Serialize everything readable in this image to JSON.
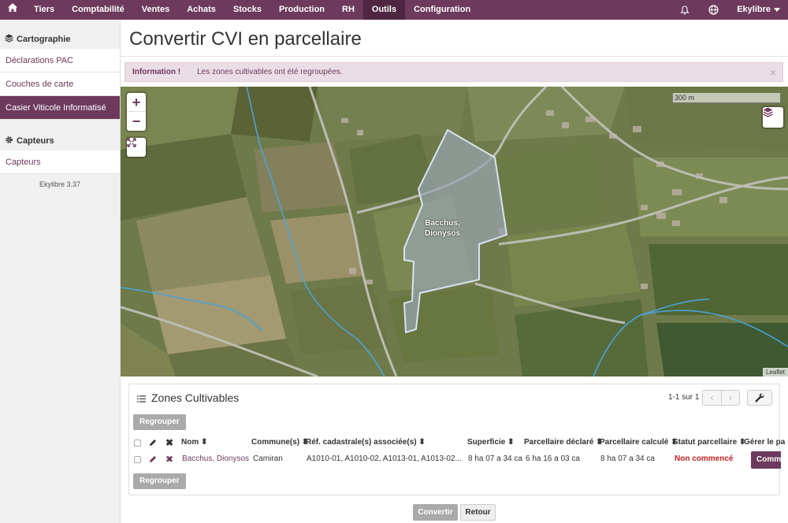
{
  "nav": {
    "items": [
      "Tiers",
      "Comptabilité",
      "Ventes",
      "Achats",
      "Stocks",
      "Production",
      "RH",
      "Outils",
      "Configuration"
    ],
    "active": "Outils",
    "user": "Ekylibre",
    "icons": [
      "home-icon",
      "bell-icon",
      "globe-icon",
      "caret-down-icon"
    ]
  },
  "sidebar": {
    "section1": "Cartographie",
    "items1": [
      "Déclarations PAC",
      "Couches de carte",
      "Casier Viticole Informatisé"
    ],
    "active": "Casier Viticole Informatisé",
    "section2": "Capteurs",
    "items2": [
      "Capteurs"
    ],
    "version": "Ekylibre 3.37"
  },
  "page": {
    "title": "Convertir CVI en parcellaire"
  },
  "alert": {
    "label": "Information !",
    "message": "Les zones cultivables ont été regroupées.",
    "close": "×"
  },
  "map": {
    "scale": "300 m",
    "attribution": "Leaflet",
    "zoom_in": "+",
    "zoom_out": "−",
    "parcel_label": "Bacchus,\nDionysos",
    "colors": {
      "parcel_fill": "#9aa4b0",
      "parcel_stroke": "#d7e3f2",
      "river": "#4aa3d8",
      "road": "#b8b8b0"
    }
  },
  "panel": {
    "title": "Zones Cultivables",
    "pager": "1-1 sur 1",
    "regroup_label": "Regrouper",
    "columns": [
      "Nom",
      "Commune(s)",
      "Réf. cadastrale(s) associée(s)",
      "Superficie",
      "Parcellaire déclaré",
      "Parcellaire calculé",
      "Statut parcellaire",
      "Gérer le pa"
    ],
    "rows": [
      {
        "nom": "Bacchus, Dionysos",
        "commune": "Camiran",
        "refs": "A1010-01, A1010-02, A1013-01, A1013-02...",
        "superficie": "8 ha 07 a 34 ca",
        "declare": "6 ha 16 a 03 ca",
        "calcule": "8 ha 07 a 34 ca",
        "statut": "Non commencé",
        "action": "Comme"
      }
    ]
  },
  "footer": {
    "convert": "Convertir",
    "back": "Retour"
  }
}
